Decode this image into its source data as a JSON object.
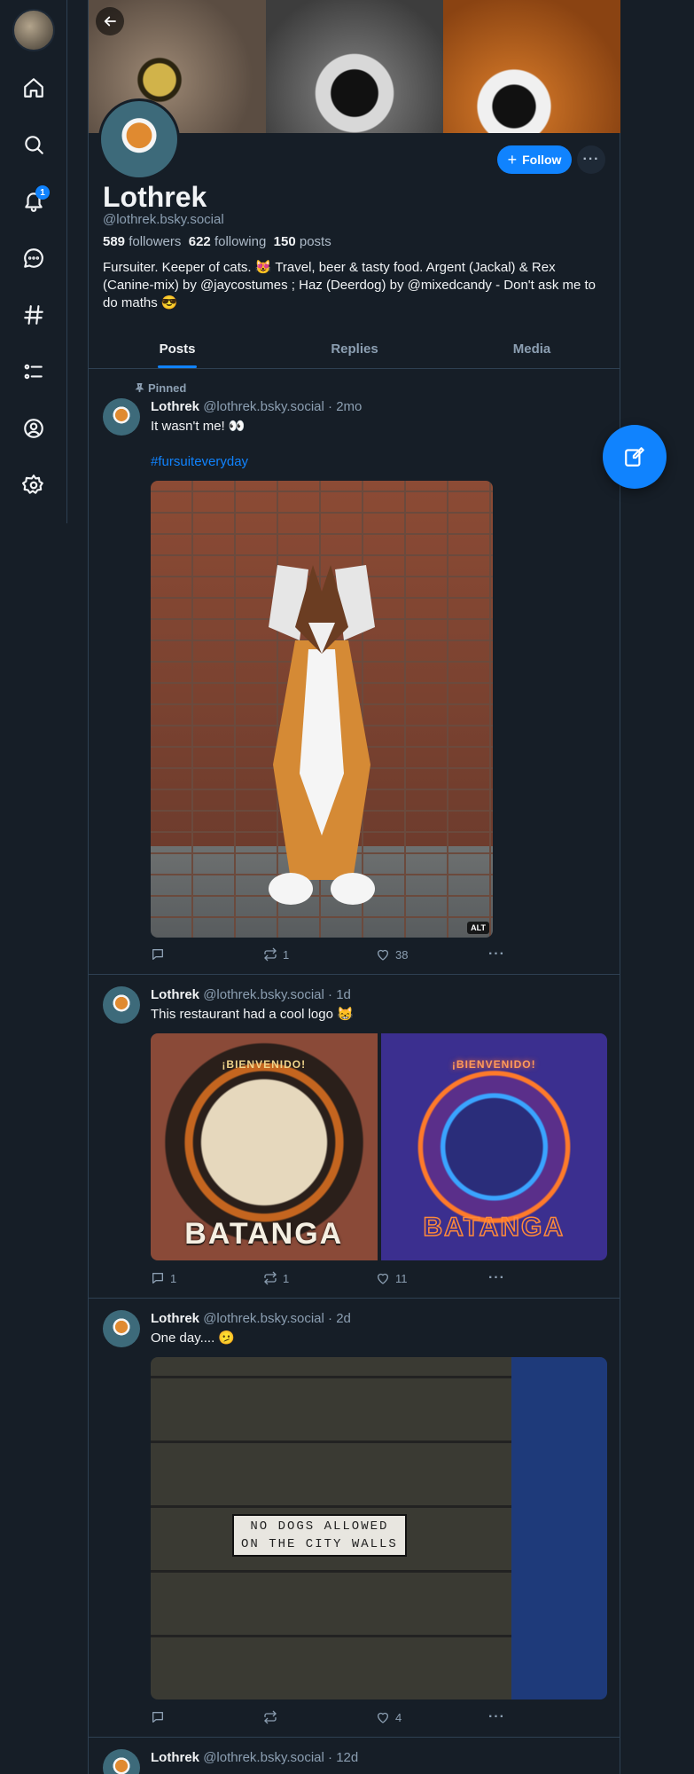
{
  "colors": {
    "background": "#161e27",
    "accent": "#1083fe",
    "border": "#2e4052",
    "muted": "#8c9fb2"
  },
  "nav": {
    "items": [
      {
        "name": "home",
        "icon": "home-icon"
      },
      {
        "name": "search",
        "icon": "search-icon"
      },
      {
        "name": "notifications",
        "icon": "bell-icon",
        "badge": "1"
      },
      {
        "name": "chat",
        "icon": "chat-icon"
      },
      {
        "name": "feeds",
        "icon": "hash-icon"
      },
      {
        "name": "lists",
        "icon": "list-icon"
      },
      {
        "name": "profile",
        "icon": "user-icon"
      },
      {
        "name": "settings",
        "icon": "gear-icon"
      }
    ]
  },
  "profile": {
    "display_name": "Lothrek",
    "handle": "@lothrek.bsky.social",
    "followers_count": "589",
    "followers_label": "followers",
    "following_count": "622",
    "following_label": "following",
    "posts_count": "150",
    "posts_label": "posts",
    "bio": "Fursuiter. Keeper of cats. 😻 Travel, beer & tasty food. Argent (Jackal) & Rex (Canine-mix) by @jaycostumes ; Haz (Deerdog) by @mixedcandy - Don't ask me to do maths 😎",
    "follow_label": "Follow",
    "more_label": "···"
  },
  "tabs": [
    "Posts",
    "Replies",
    "Media"
  ],
  "posts": [
    {
      "pinned_label": "Pinned",
      "author": "Lothrek",
      "handle": "@lothrek.bsky.social",
      "time": "· 2mo",
      "text": "It wasn't me! 👀",
      "hashtag": "#fursuiteveryday",
      "alt": "ALT",
      "replies": "",
      "reposts": "1",
      "likes": "38"
    },
    {
      "author": "Lothrek",
      "handle": "@lothrek.bsky.social",
      "time": "· 1d",
      "text": "This restaurant had a cool logo 😸",
      "logo_text": "BATANGA",
      "logo_banner": "¡BIENVENIDO!",
      "replies": "1",
      "reposts": "1",
      "likes": "11"
    },
    {
      "author": "Lothrek",
      "handle": "@lothrek.bsky.social",
      "time": "· 2d",
      "text": "One day.... 🫤",
      "sign_line1": "NO  DOGS  ALLOWED",
      "sign_line2": "ON  THE  CITY  WALLS",
      "replies": "",
      "reposts": "",
      "likes": "4"
    },
    {
      "author": "Lothrek",
      "handle": "@lothrek.bsky.social",
      "time": "· 12d"
    }
  ]
}
